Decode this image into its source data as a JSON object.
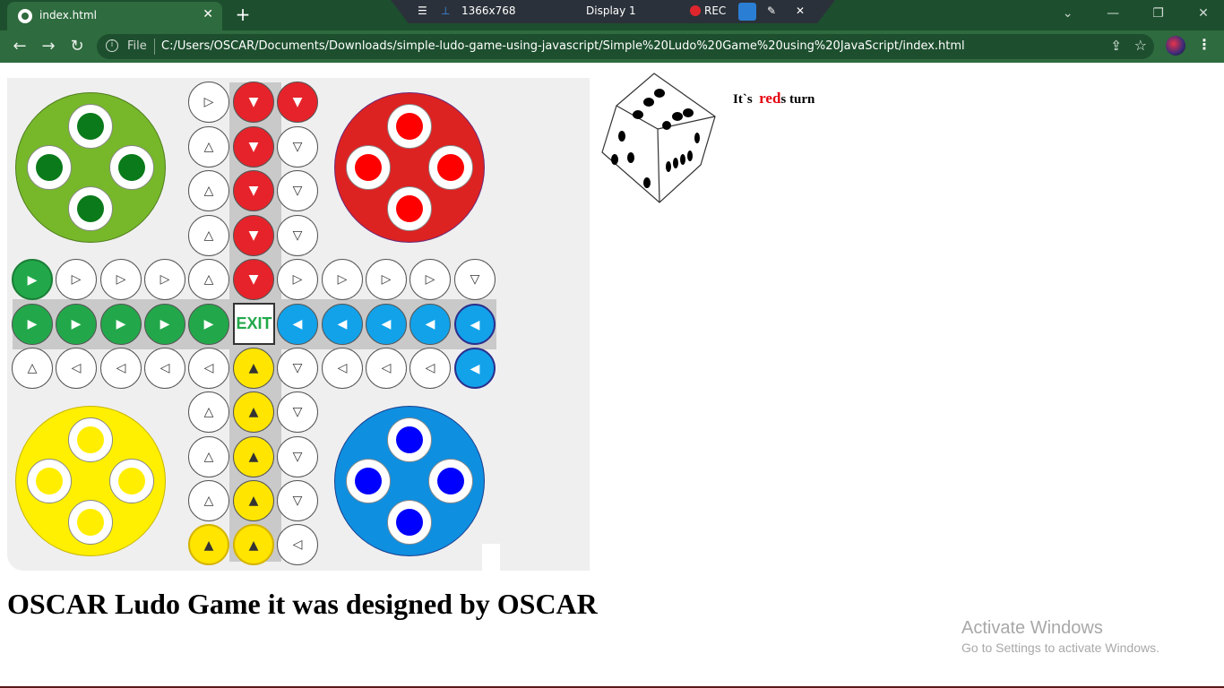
{
  "browser": {
    "tab_title": "index.html",
    "tab_close": "✕",
    "new_tab": "+",
    "file_label": "File",
    "url": "C:/Users/OSCAR/Documents/Downloads/simple-ludo-game-using-javascript/Simple%20Ludo%20Game%20using%20JavaScript/index.html",
    "back": "←",
    "forward": "→",
    "reload": "↻",
    "menu": "⋮",
    "share": "⇪",
    "star": "☆",
    "win_controls": {
      "chevron": "⌄",
      "minimize": "—",
      "restore": "❐",
      "close": "✕"
    }
  },
  "recorder": {
    "resolution": "1366x768",
    "display": "Display 1",
    "rec_label": "REC"
  },
  "game": {
    "exit_label": "EXIT",
    "turn_prefix": "It`s",
    "turn_player": "red",
    "turn_suffix": "s turn",
    "heading": "OSCAR Ludo Game it was designed by OSCAR",
    "colors": {
      "red": "#e6232a",
      "green": "#22a84a",
      "blue": "#12a2ea",
      "yellow": "#ffe500"
    }
  },
  "watermark": {
    "title": "Activate Windows",
    "subtitle": "Go to Settings to activate Windows."
  }
}
